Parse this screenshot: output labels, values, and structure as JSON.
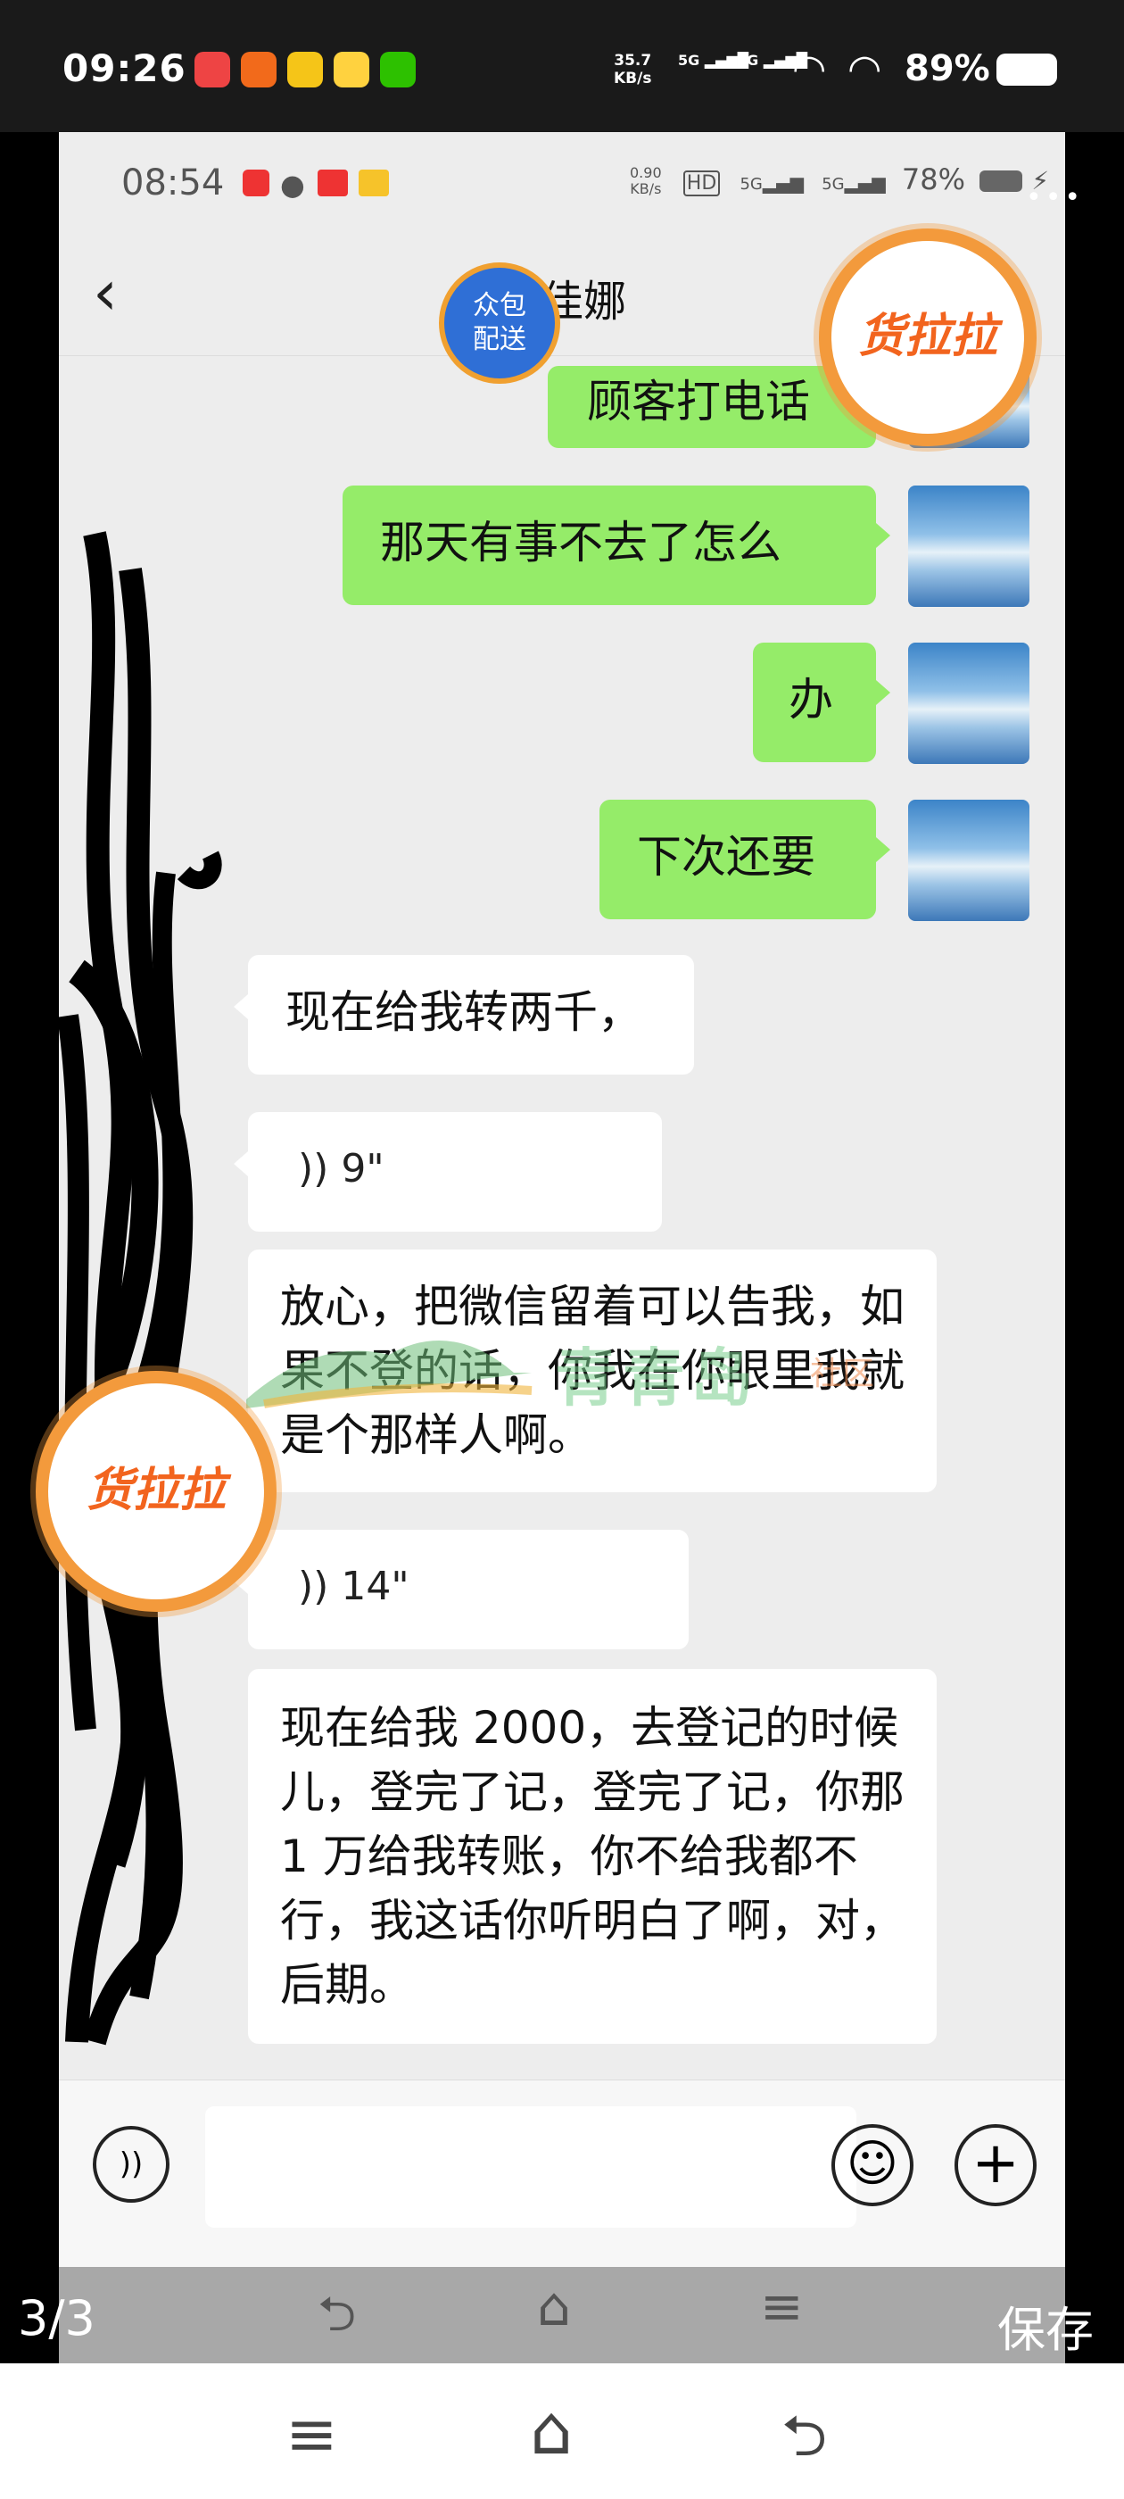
{
  "outer_status": {
    "time": "09:26",
    "net_speed_value": "35.7",
    "net_speed_unit": "KB/s",
    "signal1": "5G",
    "signal2": "5G",
    "battery": "89%"
  },
  "inner_status": {
    "time": "08:54",
    "net_speed_value": "0.90",
    "net_speed_unit": "KB/s",
    "hd": "HD",
    "signal1": "5G",
    "signal2": "5G",
    "battery": "78%"
  },
  "chat": {
    "contact_name": "佳娜",
    "badge": "众包\n配送",
    "messages": [
      {
        "side": "out",
        "text": "顾客打电话"
      },
      {
        "side": "out",
        "text": "那天有事不去了怎么"
      },
      {
        "side": "out",
        "text": "办"
      },
      {
        "side": "out",
        "text": "下次还要"
      },
      {
        "side": "in",
        "text": "现在给我转两千，"
      },
      {
        "side": "in",
        "voice": "9\""
      },
      {
        "side": "in",
        "text": "放心，把微信留着可以告我，如果不登的话，你我在你眼里我就是个那样人啊。"
      },
      {
        "side": "in",
        "voice": "14\""
      },
      {
        "side": "in",
        "text": "现在给我 2000，去登记的时候儿，登完了记，登完了记，你那 1 万给我转账，你不给我都不行，我这话你听明白了啊，对，后期。"
      }
    ]
  },
  "watermarks": {
    "huolala": "货拉拉",
    "qingdao": "青青岛",
    "qingdao_sub": "社区"
  },
  "viewer": {
    "index": "3/3",
    "save": "保存"
  },
  "colors": {
    "out_bubble": "#95ec69",
    "in_bubble": "#ffffff",
    "chat_bg": "#ededed",
    "huolala_orange": "#f39a3c"
  }
}
